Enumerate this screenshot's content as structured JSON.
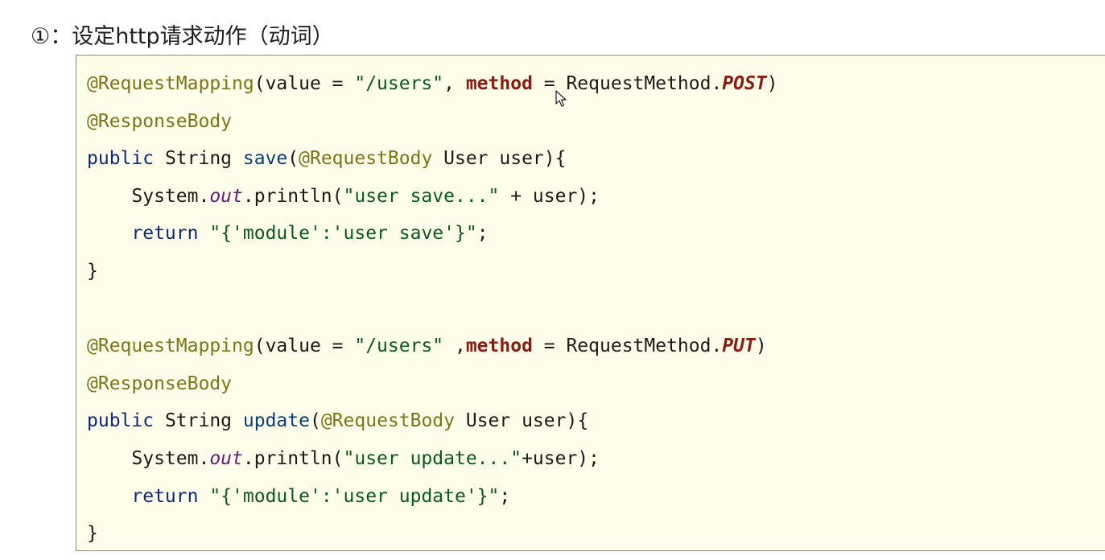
{
  "heading": {
    "marker": "①",
    "text": "：设定http请求动作（动词）"
  },
  "code": {
    "l1": {
      "ann": "@RequestMapping",
      "open": "(value = ",
      "str": "\"/users\"",
      "comma": ", ",
      "param": "method",
      "eq": " = RequestMethod.",
      "const": "POST",
      "close": ")"
    },
    "l2": {
      "ann": "@ResponseBody"
    },
    "l3": {
      "kw": "public",
      "type": " String ",
      "method": "save",
      "paren": "(",
      "ann": "@RequestBody",
      "rest": " User user){"
    },
    "l4": {
      "indent": "    ",
      "sys": "System.",
      "out": "out",
      "call": ".println(",
      "str": "\"user save...\"",
      "rest": " + user);"
    },
    "l5": {
      "indent": "    ",
      "kw": "return",
      "space": " ",
      "str": "\"{'module':'user save'}\"",
      "rest": ";"
    },
    "l6": {
      "text": "}"
    },
    "l8": {
      "ann": "@RequestMapping",
      "open": "(value = ",
      "str": "\"/users\"",
      "comma": " ,",
      "param": "method",
      "eq": " = RequestMethod.",
      "const": "PUT",
      "close": ")"
    },
    "l9": {
      "ann": "@ResponseBody"
    },
    "l10": {
      "kw": "public",
      "type": " String ",
      "method": "update",
      "paren": "(",
      "ann": "@RequestBody",
      "rest": " User user){"
    },
    "l11": {
      "indent": "    ",
      "sys": "System.",
      "out": "out",
      "call": ".println(",
      "str": "\"user update...\"",
      "rest": "+user);"
    },
    "l12": {
      "indent": "    ",
      "kw": "return",
      "space": " ",
      "str": "\"{'module':'user update'}\"",
      "rest": ";"
    },
    "l13": {
      "text": "}"
    }
  },
  "icons": {
    "cursor": "mouse-pointer-icon"
  }
}
